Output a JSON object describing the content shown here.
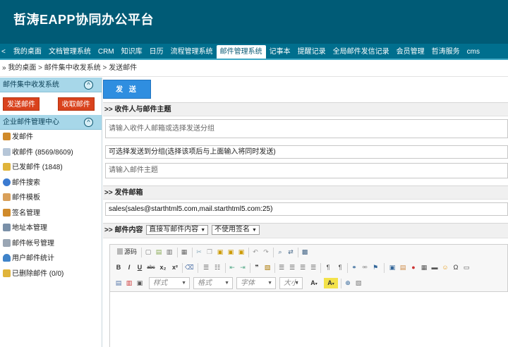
{
  "app": {
    "title": "哲涛EAPP协同办公平台"
  },
  "nav": {
    "prev": "<",
    "items": [
      "我的桌面",
      "文档管理系统",
      "CRM",
      "知识库",
      "日历",
      "流程管理系统",
      "邮件管理系统",
      "记事本",
      "提醒记录",
      "全局邮件发信记录",
      "会员管理",
      "哲涛服务",
      "cms"
    ],
    "active": "邮件管理系统"
  },
  "breadcrumb": {
    "prefix": "»",
    "items": [
      "我的桌面",
      "邮件集中收发系统",
      "发送邮件"
    ],
    "separator": ">"
  },
  "sidebar": {
    "panel1": {
      "title": "邮件集中收发系统",
      "toggle": "^",
      "buttons": [
        "发送邮件",
        "收取邮件"
      ]
    },
    "panel2": {
      "title": "企业邮件管理中心",
      "toggle": "^"
    },
    "items": [
      {
        "label": "发邮件",
        "icon": "compose-mail-icon",
        "color": "#d08a2a"
      },
      {
        "label": "收邮件 (8569/8609)",
        "icon": "inbox-icon",
        "color": "#b6c6d8"
      },
      {
        "label": "已发邮件 (1848)",
        "icon": "sent-mail-icon",
        "color": "#e0b43a"
      },
      {
        "label": "邮件搜索",
        "icon": "search-globe-icon",
        "color": "#3b7bd1"
      },
      {
        "label": "邮件模板",
        "icon": "template-icon",
        "color": "#d9a05a"
      },
      {
        "label": "签名管理",
        "icon": "signature-icon",
        "color": "#d08a2a"
      },
      {
        "label": "地址本管理",
        "icon": "address-book-icon",
        "color": "#7a90a8"
      },
      {
        "label": "邮件帐号管理",
        "icon": "account-icon",
        "color": "#9aa6b4"
      },
      {
        "label": "用户邮件统计",
        "icon": "user-icon",
        "color": "#3f83c9"
      },
      {
        "label": "已删除邮件 (0/0)",
        "icon": "trash-mail-icon",
        "color": "#e0b43a"
      }
    ]
  },
  "compose": {
    "send_label": "发 送",
    "section_recipients": ">> 收件人与邮件主题",
    "recipients_placeholder": "请输入收件人邮箱或选择发送分组",
    "group_hint": "可选择发送到分组(选择该项后与上面输入将同时发送)",
    "subject_placeholder": "请输入邮件主题",
    "section_sender": ">> 发件邮箱",
    "sender_value": "sales(sales@starthtml5.com,mail.starthtml5.com:25)",
    "section_content": ">> 邮件内容",
    "content_mode": "直接写邮件内容",
    "signature_mode": "不使用签名"
  },
  "editor": {
    "source_label": "源码",
    "combo_style": "样式",
    "combo_format": "格式",
    "combo_font": "字体",
    "combo_size": "大小",
    "bold": "B",
    "italic": "I",
    "underline": "U",
    "strike": "abc",
    "subscript": "x₂",
    "superscript": "x²",
    "quote": "❞"
  },
  "colors": {
    "header": "#005b76",
    "nav": "#006f8e",
    "panel": "#a7d7e9",
    "send": "#2f8ee0",
    "red_button": "#d9421d"
  }
}
